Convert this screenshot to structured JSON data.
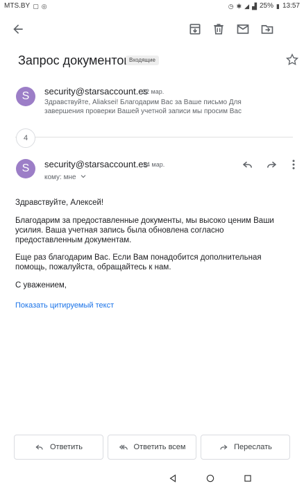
{
  "status_bar": {
    "carrier": "MTS.BY",
    "battery": "25%",
    "time": "13:57"
  },
  "toolbar": {
    "icons": [
      "back-arrow-icon",
      "archive-icon",
      "delete-icon",
      "mark-unread-icon",
      "move-to-icon"
    ]
  },
  "subject": "Запрос документов",
  "label": "Входящие",
  "collapsed_message": {
    "avatar_letter": "S",
    "sender": "security@starsaccount.es",
    "date": "22 мар.",
    "snippet": "Здравствуйте, Aliaksei! Благодарим Вас за Ваше письмо Для завершения проверки Вашей учетной записи мы просим Вас"
  },
  "hidden_count": "4",
  "open_message": {
    "avatar_letter": "S",
    "sender": "security@starsaccount.es",
    "date": "24 мар.",
    "recipient": "кому: мне",
    "greeting": "Здравствуйте, Алексей!",
    "paragraph1": "Благодарим за предоставленные документы, мы высоко ценим Ваши усилия. Ваша учетная запись была обновлена согласно предоставленным документам.",
    "paragraph2": "Еще раз благодарим Вас. Если Вам понадобится дополнительная помощь, пожалуйста, обращайтесь к нам.",
    "closing": "С уважением,",
    "show_quoted": "Показать цитируемый текст"
  },
  "actions": {
    "reply": "Ответить",
    "reply_all": "Ответить всем",
    "forward": "Переслать"
  }
}
